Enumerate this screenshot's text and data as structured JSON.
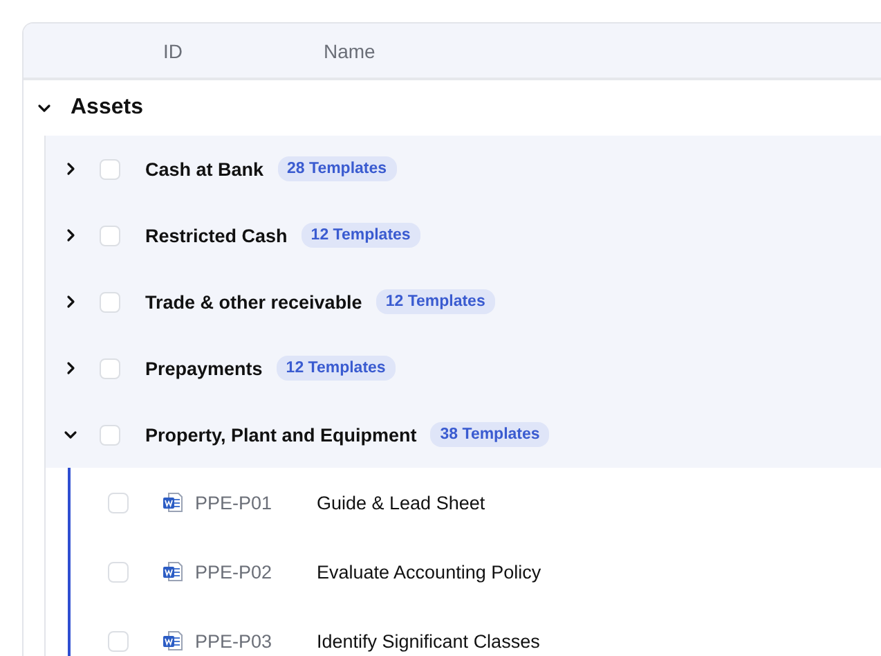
{
  "table": {
    "columns": [
      "ID",
      "Name"
    ],
    "sections": [
      {
        "label": "Assets",
        "expanded": true,
        "groups": [
          {
            "name": "Cash at Bank",
            "badge": "28 Templates",
            "expanded": false,
            "checked": false
          },
          {
            "name": "Restricted Cash",
            "badge": "12 Templates",
            "expanded": false,
            "checked": false
          },
          {
            "name": "Trade & other receivable",
            "badge": "12 Templates",
            "expanded": false,
            "checked": false
          },
          {
            "name": "Prepayments",
            "badge": "12 Templates",
            "expanded": false,
            "checked": false
          },
          {
            "name": "Property, Plant and Equipment",
            "badge": "38 Templates",
            "expanded": true,
            "checked": false,
            "documents": [
              {
                "id": "PPE-P01",
                "name": "Guide & Lead Sheet",
                "checked": false
              },
              {
                "id": "PPE-P02",
                "name": "Evaluate Accounting Policy",
                "checked": false
              },
              {
                "id": "PPE-P03",
                "name": "Identify Significant Classes",
                "checked": false
              }
            ]
          }
        ]
      }
    ]
  }
}
